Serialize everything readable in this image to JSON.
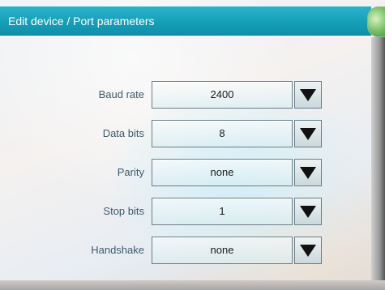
{
  "window": {
    "title": "Edit device / Port parameters"
  },
  "params": [
    {
      "label": "Baud rate",
      "value": "2400"
    },
    {
      "label": "Data bits",
      "value": "8"
    },
    {
      "label": "Parity",
      "value": "none"
    },
    {
      "label": "Stop bits",
      "value": "1"
    },
    {
      "label": "Handshake",
      "value": "none"
    }
  ],
  "icons": {
    "dropdown": "triangle-down-icon"
  },
  "colors": {
    "titlebar": "#169fb8",
    "label_text": "#3d5a6c",
    "corner_button": "#7cc16a"
  }
}
